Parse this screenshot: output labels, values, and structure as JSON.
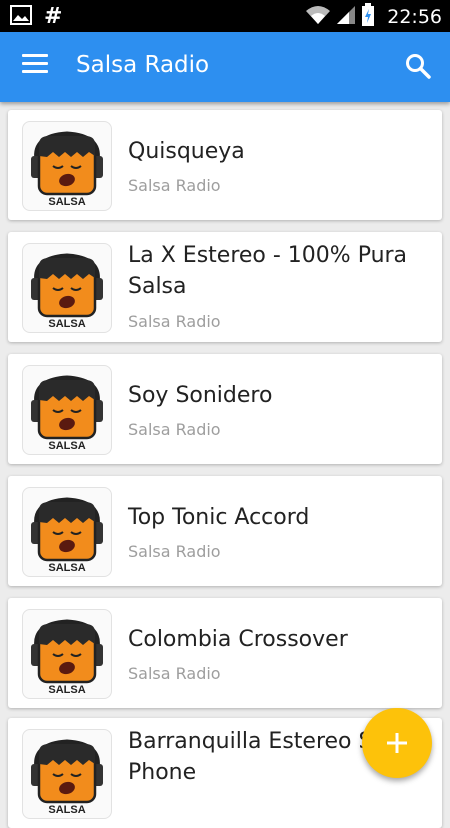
{
  "status_bar": {
    "time": "22:56",
    "icons": [
      "image-icon",
      "hash-icon",
      "wifi-icon",
      "signal-icon",
      "battery-icon"
    ]
  },
  "app_bar": {
    "title": "Salsa Radio",
    "menu_icon": "menu-icon",
    "search_icon": "search-icon"
  },
  "thumbnail_label": "SALSA",
  "stations": [
    {
      "name": "Quisqueya",
      "category": "Salsa Radio"
    },
    {
      "name": "La X Estereo - 100% Pura Salsa",
      "category": "Salsa Radio"
    },
    {
      "name": "Soy Sonidero",
      "category": "Salsa Radio"
    },
    {
      "name": "Top Tonic Accord",
      "category": "Salsa Radio"
    },
    {
      "name": "Colombia Crossover",
      "category": "Salsa Radio"
    },
    {
      "name": "Barranquilla Estereo S Phone",
      "category": ""
    }
  ],
  "fab": {
    "icon": "plus-icon"
  },
  "colors": {
    "app_bar": "#2d8ff0",
    "fab": "#fdc20a",
    "background": "#ececec"
  }
}
